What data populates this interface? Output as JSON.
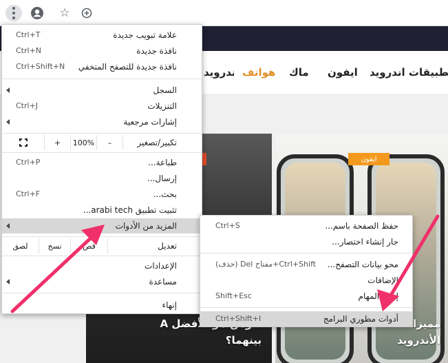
{
  "browser": {
    "icons": {
      "menu": "kebab-icon",
      "profile": "account-circle-icon",
      "bookmark": "star-icon",
      "add": "plus-circle-icon"
    }
  },
  "site": {
    "nav": [
      {
        "label": "تطبيقات اندرويد",
        "active": false
      },
      {
        "label": "ايفون",
        "active": false
      },
      {
        "label": "ماك",
        "active": false
      },
      {
        "label": "هواتف",
        "active": true
      },
      {
        "label": "اندرويد",
        "active": false
      }
    ],
    "badge": "ايفون",
    "headline_left": {
      "line1": "؟ ومن هو الأفضل",
      "line1_prefix": "A",
      "line2": "بينهما؟"
    },
    "headline_right": {
      "line1": "مميزا",
      "line2": "الأندرويد"
    },
    "accent_color": "#e0902a"
  },
  "menu": {
    "items_top": [
      {
        "label": "علامة تبويب جديدة",
        "shortcut": "Ctrl+T"
      },
      {
        "label": "نافذة جديدة",
        "shortcut": "Ctrl+N"
      },
      {
        "label": "نافذة جديدة للتصفح المتخفي",
        "shortcut": "Ctrl+Shift+N"
      }
    ],
    "items_history": [
      {
        "label": "السجل",
        "shortcut": "",
        "submenu": true
      },
      {
        "label": "التنزيلات",
        "shortcut": "Ctrl+J",
        "submenu": false
      },
      {
        "label": "إشارات مرجعية",
        "shortcut": "",
        "submenu": true
      }
    ],
    "zoom": {
      "label": "تكبير/تصغير",
      "minus": "–",
      "value": "100%",
      "plus": "+"
    },
    "items_print": [
      {
        "label": "طباعة...",
        "shortcut": "Ctrl+P"
      },
      {
        "label": "إرسال...",
        "shortcut": ""
      },
      {
        "label": "بحث...",
        "shortcut": "Ctrl+F"
      },
      {
        "label": "تثبيت تطبيق arabi tech...",
        "shortcut": ""
      },
      {
        "label": "المزيد من الأدوات",
        "shortcut": "",
        "submenu": true
      }
    ],
    "edit": {
      "label": "تعديل",
      "cut": "قص",
      "copy": "نسخ",
      "paste": "لصق"
    },
    "items_settings": [
      {
        "label": "الإعدادات",
        "submenu": false
      },
      {
        "label": "مساعدة",
        "submenu": true
      }
    ],
    "exit": "إنهاء"
  },
  "submenu": {
    "items": [
      {
        "label": "حفظ الصفحة باسم...",
        "shortcut": "Ctrl+S"
      },
      {
        "label": "جار إنشاء اختصار...",
        "shortcut": ""
      },
      {
        "label": "محو بيانات التصفح...",
        "shortcut": "Ctrl+Shift+مفتاح Del (حذف)"
      },
      {
        "label": "الإضافات",
        "shortcut": ""
      },
      {
        "label": "إدارة المهام",
        "shortcut": "Shift+Esc"
      },
      {
        "label": "أدوات مطوري البرامج",
        "shortcut": "Ctrl+Shift+I"
      }
    ]
  },
  "annotation": {
    "arrow_color": "#f0306a"
  }
}
